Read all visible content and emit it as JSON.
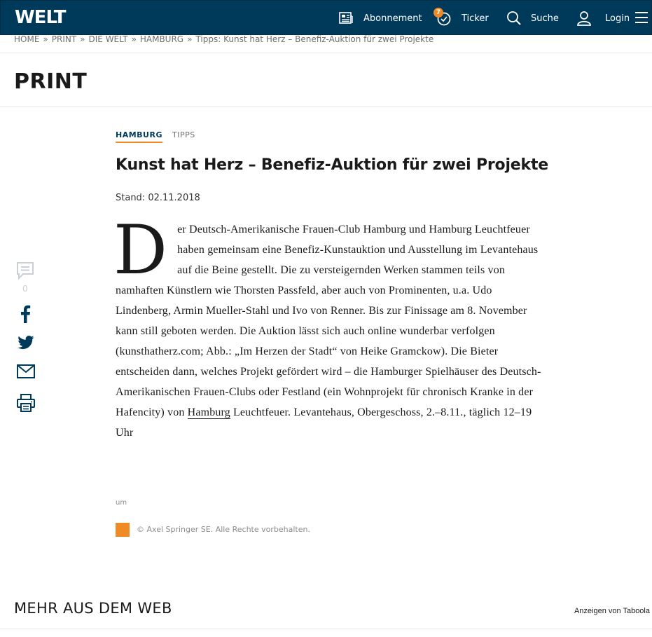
{
  "header": {
    "logo": "WELT",
    "nav": {
      "abonnement": "Abonnement",
      "ticker": "Ticker",
      "ticker_badge": "7",
      "suche": "Suche",
      "login": "Login"
    }
  },
  "breadcrumb": {
    "items": [
      "HOME",
      "PRINT",
      "DIE WELT",
      "HAMBURG",
      "Tipps: Kunst hat Herz – Benefiz-Auktion für zwei Projekte"
    ],
    "separator": "»"
  },
  "section": {
    "title": "PRINT"
  },
  "article": {
    "kicker_primary": "HAMBURG",
    "kicker_secondary": "TIPPS",
    "headline": "Kunst hat Herz – Benefiz-Auktion für zwei Projekte",
    "stand": "Stand: 02.11.2018",
    "dropcap": "D",
    "body_part1": "er Deutsch-Amerikanische Frauen-Club Hamburg und Hamburg Leuchtfeuer haben gemeinsam eine Benefiz-Kunstauktion und Ausstellung im Levantehaus auf die Beine gestellt. Die zu versteigernden Werken stammen teils von namhaften Künstlern wie Thorsten Passfeld, aber auch von Prominenten, u.a. Udo Lindenberg, Armin Mueller-Stahl und Ivo von Renner. Bis zur Finissage am 8. November kann still geboten werden. Die Auktion lässt sich auch online wunderbar verfolgen (kunsthatherz.com; Abb.: „Im Herzen der Stadt“ von Heike Gramckow). Die Bieter entscheiden dann, welches Projekt gefördert wird – die Hamburger Spielhäuser des Deutsch-Amerikanischen Frauen-Clubs oder Festland (ein Wohnprojekt für chronisch Kranke in der Hafencity) von ",
    "body_link": "Hamburg",
    "body_part2": " Leuchtfeuer. Levantehaus, Obergeschoss, 2.–8.11., täglich 12–19 Uhr",
    "author": "um",
    "copyright": "© Axel Springer SE. Alle Rechte vorbehalten."
  },
  "social": {
    "comment_count": "0"
  },
  "footer": {
    "mehr": "MEHR AUS DEM WEB",
    "taboola": "Anzeigen von Taboola"
  },
  "colors": {
    "brand": "#003a5a",
    "accent": "#f08a24",
    "icon": "#003a5a"
  }
}
